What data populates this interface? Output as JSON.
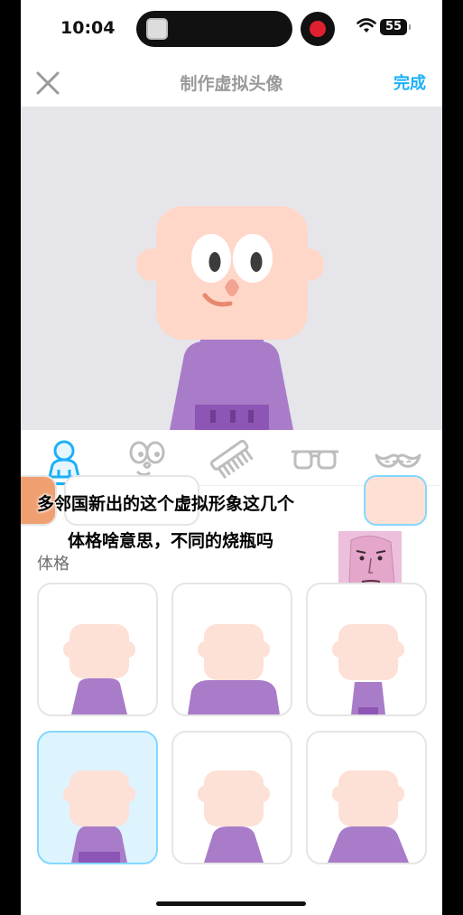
{
  "status_bar": {
    "time": "10:04",
    "battery": "55"
  },
  "nav": {
    "title": "制作虚拟头像",
    "done_label": "完成"
  },
  "tabs": [
    {
      "name": "body",
      "icon": "person-icon",
      "selected": true
    },
    {
      "name": "face",
      "icon": "face-icon",
      "selected": false
    },
    {
      "name": "hair",
      "icon": "comb-icon",
      "selected": false
    },
    {
      "name": "glasses",
      "icon": "glasses-icon",
      "selected": false
    },
    {
      "name": "facial-hair",
      "icon": "mustache-icon",
      "selected": false
    }
  ],
  "caption": {
    "line1": "多邻国新出的这个虚拟形象这几个",
    "line2": "体格啥意思，不同的烧瓶吗"
  },
  "section": {
    "label": "体格"
  },
  "body_options": [
    {
      "variant": "narrow",
      "selected": false
    },
    {
      "variant": "broad",
      "selected": false
    },
    {
      "variant": "slim",
      "selected": false
    },
    {
      "variant": "default",
      "selected": true
    },
    {
      "variant": "round",
      "selected": false
    },
    {
      "variant": "wide",
      "selected": false
    }
  ],
  "colors": {
    "accent": "#1cb0f6",
    "skin": "#fde0d6",
    "preview_skin": "#ffd7c9",
    "shirt": "#a97cc9",
    "shirt_dark": "#8d55b5",
    "preview_bg": "#e5e5ea"
  }
}
